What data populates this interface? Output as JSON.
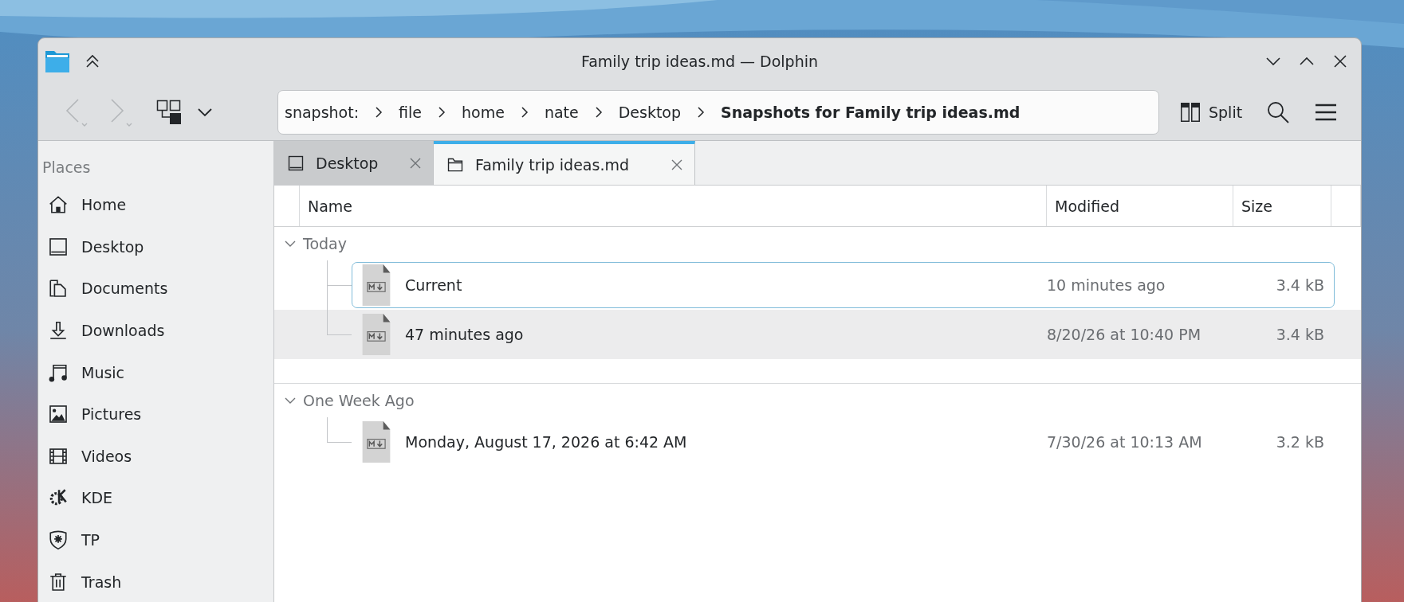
{
  "window": {
    "title": "Family trip ideas.md — Dolphin"
  },
  "toolbar": {
    "back": {
      "disabled": true
    },
    "forward": {
      "disabled": true
    },
    "split": {
      "label": "Split"
    }
  },
  "location": [
    {
      "label": "snapshot:",
      "current": false
    },
    {
      "label": "file",
      "current": false
    },
    {
      "label": "home",
      "current": false
    },
    {
      "label": "nate",
      "current": false
    },
    {
      "label": "Desktop",
      "current": false
    },
    {
      "label": "Snapshots for Family trip ideas.md",
      "current": true
    }
  ],
  "sidebar": {
    "heading": "Places",
    "items": [
      {
        "label": "Home",
        "kind": "home"
      },
      {
        "label": "Desktop",
        "kind": "desktop"
      },
      {
        "label": "Documents",
        "kind": "documents"
      },
      {
        "label": "Downloads",
        "kind": "downloads"
      },
      {
        "label": "Music",
        "kind": "music"
      },
      {
        "label": "Pictures",
        "kind": "pictures"
      },
      {
        "label": "Videos",
        "kind": "videos"
      },
      {
        "label": "KDE",
        "kind": "kde"
      },
      {
        "label": "TP",
        "kind": "tp"
      },
      {
        "label": "Trash",
        "kind": "trash"
      }
    ]
  },
  "tabs": [
    {
      "label": "Desktop",
      "kind": "desktop",
      "selected": false
    },
    {
      "label": "Family trip ideas.md",
      "kind": "folder",
      "selected": true
    }
  ],
  "columns": [
    "Name",
    "Modified",
    "Size"
  ],
  "groups": [
    {
      "label": "Today",
      "expanded": true,
      "rows": [
        {
          "name": "Current",
          "modified": "10 minutes ago",
          "size": "3.4 kB",
          "focused": true,
          "hovered": false
        },
        {
          "name": "47 minutes ago",
          "modified": "8/20/26 at 10:40 PM",
          "size": "3.4 kB",
          "focused": false,
          "hovered": true
        }
      ]
    },
    {
      "label": "One Week Ago",
      "expanded": true,
      "rows": [
        {
          "name": "Monday, August 17, 2026 at 6:42 AM",
          "modified": "7/30/26 at 10:13 AM",
          "size": "3.2 kB",
          "focused": false,
          "hovered": false
        }
      ]
    }
  ]
}
